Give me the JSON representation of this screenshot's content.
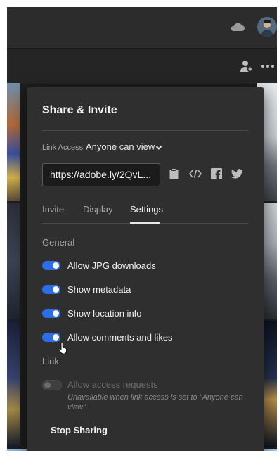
{
  "header": {
    "cloud_icon": "cloud-icon",
    "avatar_icon": "user-avatar"
  },
  "subbar": {
    "add_person_icon": "add-person-icon",
    "more_icon": "more-icon"
  },
  "panel": {
    "title": "Share & Invite",
    "link_access": {
      "label": "Link Access",
      "value": "Anyone can view"
    },
    "url": "https://adobe.ly/2QvL...",
    "share_icons": [
      "clipboard-icon",
      "embed-code-icon",
      "facebook-icon",
      "twitter-icon"
    ],
    "tabs": [
      {
        "label": "Invite",
        "active": false
      },
      {
        "label": "Display",
        "active": false
      },
      {
        "label": "Settings",
        "active": true
      }
    ],
    "general_label": "General",
    "toggles": [
      {
        "label": "Allow JPG downloads",
        "on": true
      },
      {
        "label": "Show metadata",
        "on": true
      },
      {
        "label": "Show location info",
        "on": true
      },
      {
        "label": "Allow comments and likes",
        "on": true
      }
    ],
    "link_label": "Link",
    "access_requests": {
      "label": "Allow access requests",
      "on": false,
      "hint": "Unavailable when link access is set to \"Anyone can view\""
    },
    "stop_sharing": "Stop Sharing"
  },
  "colors": {
    "accent": "#2d6de6",
    "panel_bg": "#2f2f2f"
  }
}
